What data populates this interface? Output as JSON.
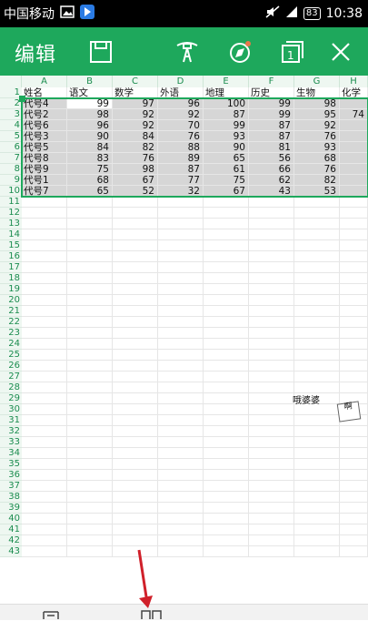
{
  "statusbar": {
    "carrier": "中国移动",
    "battery": "83",
    "time": "10:38"
  },
  "toolbar": {
    "title": "编辑"
  },
  "sheet": {
    "columns": [
      "A",
      "B",
      "C",
      "D",
      "E",
      "F",
      "G",
      "H"
    ],
    "header_row": [
      "姓名",
      "语文",
      "数学",
      "外语",
      "地理",
      "历史",
      "生物",
      "化学"
    ],
    "rows": [
      [
        "代号4",
        "99",
        "97",
        "96",
        "100",
        "99",
        "98"
      ],
      [
        "代号2",
        "98",
        "92",
        "92",
        "87",
        "99",
        "95",
        "74"
      ],
      [
        "代号6",
        "96",
        "92",
        "70",
        "99",
        "87",
        "92"
      ],
      [
        "代号3",
        "90",
        "84",
        "76",
        "93",
        "87",
        "76"
      ],
      [
        "代号5",
        "84",
        "82",
        "88",
        "90",
        "81",
        "93"
      ],
      [
        "代号8",
        "83",
        "76",
        "89",
        "65",
        "56",
        "68"
      ],
      [
        "代号9",
        "75",
        "98",
        "87",
        "61",
        "66",
        "76"
      ],
      [
        "代号1",
        "68",
        "67",
        "77",
        "75",
        "62",
        "82"
      ],
      [
        "代号7",
        "65",
        "52",
        "32",
        "67",
        "43",
        "53"
      ]
    ],
    "row_numbers": [
      "1",
      "2",
      "3",
      "4",
      "5",
      "6",
      "7",
      "8",
      "9",
      "10",
      "11",
      "12",
      "13",
      "14",
      "15",
      "16",
      "17",
      "18",
      "19",
      "20",
      "21",
      "22",
      "23",
      "24",
      "25",
      "26",
      "27",
      "28",
      "29",
      "30",
      "31",
      "32",
      "33",
      "34",
      "35",
      "36",
      "37",
      "38",
      "39",
      "40",
      "41",
      "42",
      "43"
    ],
    "floating_text": "哦婆婆",
    "stamp_text": "啊"
  },
  "colors": {
    "toolbar": "#1ea85c",
    "selection": "#d6d6d6",
    "arrow": "#d0202a"
  },
  "icons": [
    "save-icon",
    "format-painter-icon",
    "compass-icon",
    "window-count-icon",
    "close-icon",
    "table-view-icon",
    "split-view-icon"
  ],
  "window_count": "1"
}
